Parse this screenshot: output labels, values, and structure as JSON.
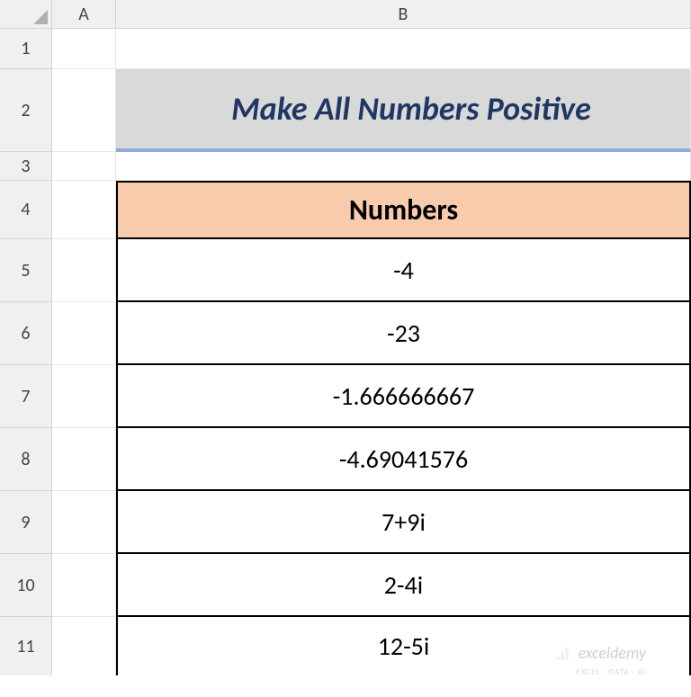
{
  "columns": [
    "A",
    "B"
  ],
  "rows": [
    "1",
    "2",
    "3",
    "4",
    "5",
    "6",
    "7",
    "8",
    "9",
    "10",
    "11"
  ],
  "title": "Make All Numbers Positive",
  "table": {
    "header": "Numbers",
    "values": [
      "-4",
      "-23",
      "-1.666666667",
      "-4.69041576",
      "7+9i",
      "2-4i",
      "12-5i"
    ]
  },
  "watermark": {
    "main": "exceldemy",
    "sub": "EXCEL · DATA · BI"
  },
  "chart_data": {
    "type": "table",
    "title": "Make All Numbers Positive",
    "columns": [
      "Numbers"
    ],
    "rows": [
      [
        "-4"
      ],
      [
        "-23"
      ],
      [
        "-1.666666667"
      ],
      [
        "-4.69041576"
      ],
      [
        "7+9i"
      ],
      [
        "2-4i"
      ],
      [
        "12-5i"
      ]
    ]
  }
}
